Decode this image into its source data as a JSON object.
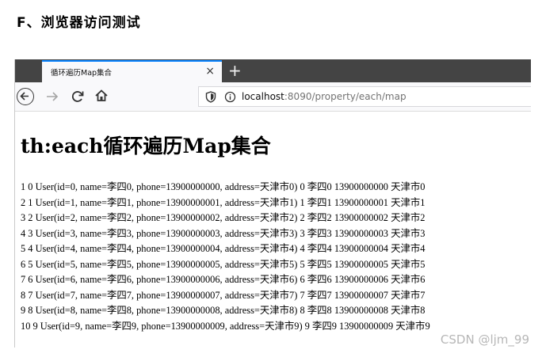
{
  "doc_heading": "F、浏览器访问测试",
  "browser": {
    "tab_title": "循环遍历Map集合",
    "tab_close": "×",
    "new_tab": "+",
    "url_host": "localhost",
    "url_path": ":8090/property/each/map"
  },
  "page": {
    "title": "th:each循环遍历Map集合",
    "rows": [
      "1 0 User(id=0, name=李四0, phone=13900000000, address=天津市0) 0 李四0 13900000000 天津市0",
      "2 1 User(id=1, name=李四1, phone=13900000001, address=天津市1) 1 李四1 13900000001 天津市1",
      "3 2 User(id=2, name=李四2, phone=13900000002, address=天津市2) 2 李四2 13900000002 天津市2",
      "4 3 User(id=3, name=李四3, phone=13900000003, address=天津市3) 3 李四3 13900000003 天津市3",
      "5 4 User(id=4, name=李四4, phone=13900000004, address=天津市4) 4 李四4 13900000004 天津市4",
      "6 5 User(id=5, name=李四5, phone=13900000005, address=天津市5) 5 李四5 13900000005 天津市5",
      "7 6 User(id=6, name=李四6, phone=13900000006, address=天津市6) 6 李四6 13900000006 天津市6",
      "8 7 User(id=7, name=李四7, phone=13900000007, address=天津市7) 7 李四7 13900000007 天津市7",
      "9 8 User(id=8, name=李四8, phone=13900000008, address=天津市8) 8 李四8 13900000008 天津市8",
      "10 9 User(id=9, name=李四9, phone=13900000009, address=天津市9) 9 李四9 13900000009 天津市9"
    ]
  },
  "watermark": "CSDN @ljm_99"
}
